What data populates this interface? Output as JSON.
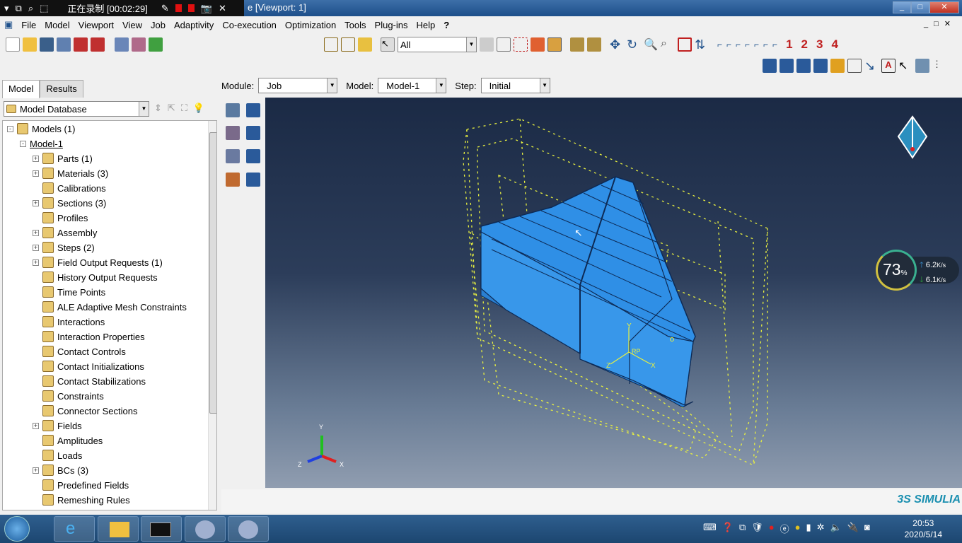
{
  "recorder": {
    "status": "正在录制 [00:02:29]"
  },
  "window": {
    "title": "e [Viewport: 1]"
  },
  "menu": [
    "File",
    "Model",
    "Viewport",
    "View",
    "Job",
    "Adaptivity",
    "Co-execution",
    "Optimization",
    "Tools",
    "Plug-ins",
    "Help",
    "?"
  ],
  "toolbar": {
    "selection_filter": "All"
  },
  "tabs": [
    "Model",
    "Results"
  ],
  "tree": {
    "database": "Model Database",
    "items": [
      {
        "label": "Models (1)",
        "level": 0,
        "exp": "-"
      },
      {
        "label": "Model-1",
        "level": 1,
        "exp": "-"
      },
      {
        "label": "Parts (1)",
        "level": 2,
        "exp": "+"
      },
      {
        "label": "Materials (3)",
        "level": 2,
        "exp": "+"
      },
      {
        "label": "Calibrations",
        "level": 2,
        "exp": ""
      },
      {
        "label": "Sections (3)",
        "level": 2,
        "exp": "+"
      },
      {
        "label": "Profiles",
        "level": 2,
        "exp": ""
      },
      {
        "label": "Assembly",
        "level": 2,
        "exp": "+"
      },
      {
        "label": "Steps (2)",
        "level": 2,
        "exp": "+"
      },
      {
        "label": "Field Output Requests (1)",
        "level": 2,
        "exp": "+"
      },
      {
        "label": "History Output Requests",
        "level": 2,
        "exp": ""
      },
      {
        "label": "Time Points",
        "level": 2,
        "exp": ""
      },
      {
        "label": "ALE Adaptive Mesh Constraints",
        "level": 2,
        "exp": ""
      },
      {
        "label": "Interactions",
        "level": 2,
        "exp": ""
      },
      {
        "label": "Interaction Properties",
        "level": 2,
        "exp": ""
      },
      {
        "label": "Contact Controls",
        "level": 2,
        "exp": ""
      },
      {
        "label": "Contact Initializations",
        "level": 2,
        "exp": ""
      },
      {
        "label": "Contact Stabilizations",
        "level": 2,
        "exp": ""
      },
      {
        "label": "Constraints",
        "level": 2,
        "exp": ""
      },
      {
        "label": "Connector Sections",
        "level": 2,
        "exp": ""
      },
      {
        "label": "Fields",
        "level": 2,
        "exp": "+"
      },
      {
        "label": "Amplitudes",
        "level": 2,
        "exp": ""
      },
      {
        "label": "Loads",
        "level": 2,
        "exp": ""
      },
      {
        "label": "BCs (3)",
        "level": 2,
        "exp": "+"
      },
      {
        "label": "Predefined Fields",
        "level": 2,
        "exp": ""
      },
      {
        "label": "Remeshing Rules",
        "level": 2,
        "exp": ""
      }
    ]
  },
  "context": {
    "module_label": "Module:",
    "module": "Job",
    "model_label": "Model:",
    "model": "Model-1",
    "step_label": "Step:",
    "step": "Initial"
  },
  "viewport": {
    "triad": {
      "x": "X",
      "y": "Y",
      "z": "Z"
    },
    "rp": "RP",
    "part_color": "#2f8fe6",
    "wire_color": "#e8f040"
  },
  "toolbar_numbers": [
    "1",
    "2",
    "3",
    "4"
  ],
  "netmon": {
    "cpu": "73",
    "unit": "%",
    "up": "6.2",
    "down": "6.1",
    "rate_unit": "K/s"
  },
  "brand": "3S SIMULIA",
  "clock": {
    "time": "20:53",
    "date": "2020/5/14"
  }
}
